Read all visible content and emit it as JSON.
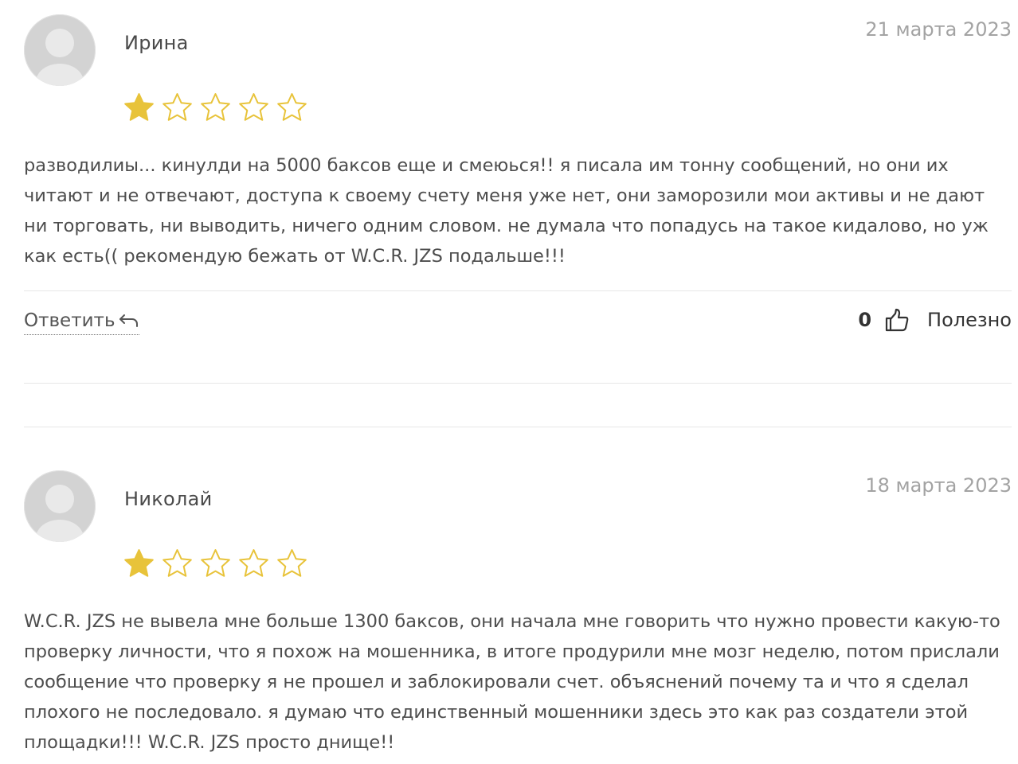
{
  "reviews": [
    {
      "author": "Ирина",
      "date": "21 марта 2023",
      "rating": 1,
      "max_rating": 5,
      "text": "разводилиы... кинулди на 5000 баксов еще и смеюься!! я писала им тонну сообщений, но они их читают и не отвечают, доступа к своему счету меня уже нет, они заморозили мои активы и не дают ни торговать, ни выводить, ничего одним словом. не думала что попадусь на такое кидалово, но уж как есть(( рекомендую бежать от W.C.R. JZS подальше!!!",
      "reply_label": "Ответить",
      "like_count": "0",
      "useful_label": "Полезно"
    },
    {
      "author": "Николай",
      "date": "18 марта 2023",
      "rating": 1,
      "max_rating": 5,
      "text": "W.C.R. JZS не вывела мне больше 1300 баксов, они начала мне говорить что нужно провести какую-то проверку личности, что я похож на мошенника, в итоге продурили мне мозг неделю, потом прислали сообщение что проверку я не прошел и заблокировали счет. объяснений почему та и что я сделал плохого не последовало. я думаю что единственный мошенники здесь это как раз создатели этой площадки!!! W.C.R. JZS просто днище!!"
    }
  ],
  "colors": {
    "star_fill": "#e8c33a",
    "star_outline": "#e8c33a",
    "text": "#4d4d4d",
    "date": "#a3a3a3",
    "separator": "#e6e6e6"
  },
  "icons": {
    "avatar": "avatar-placeholder-icon",
    "star_filled": "star-filled-icon",
    "star_empty": "star-outline-icon",
    "reply": "reply-arrow-icon",
    "like": "thumbs-up-icon"
  }
}
